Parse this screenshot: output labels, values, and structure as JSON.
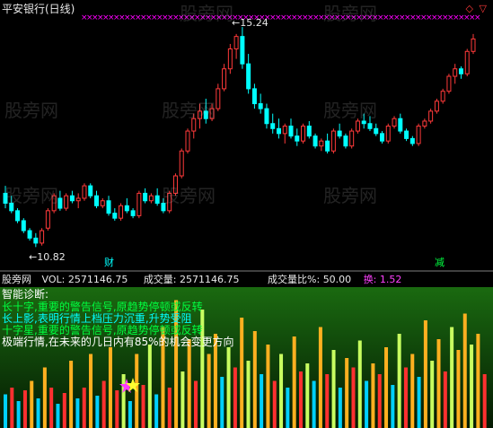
{
  "window": {
    "title": "平安银行(日线)",
    "close_icon": "diamond-close-icon",
    "restore_icon": "triangle-restore-icon"
  },
  "price_panel": {
    "high_label": "15.24",
    "low_label": "10.82",
    "markers": [
      "财",
      "减"
    ],
    "ghost_watermark": "股旁网",
    "candles": [
      [
        11.9,
        12.05,
        11.6,
        11.7
      ],
      [
        11.7,
        11.85,
        11.5,
        11.55
      ],
      [
        11.55,
        11.6,
        11.3,
        11.35
      ],
      [
        11.35,
        11.4,
        11.1,
        11.15
      ],
      [
        11.15,
        11.2,
        10.95,
        11.0
      ],
      [
        11.0,
        11.1,
        10.82,
        10.9
      ],
      [
        10.9,
        11.2,
        10.85,
        11.15
      ],
      [
        11.2,
        11.6,
        11.15,
        11.55
      ],
      [
        11.55,
        11.9,
        11.5,
        11.85
      ],
      [
        11.8,
        11.95,
        11.55,
        11.6
      ],
      [
        11.6,
        11.9,
        11.55,
        11.85
      ],
      [
        11.85,
        11.95,
        11.7,
        11.75
      ],
      [
        11.75,
        11.9,
        11.6,
        11.8
      ],
      [
        11.8,
        12.1,
        11.75,
        12.05
      ],
      [
        12.05,
        12.1,
        11.8,
        11.85
      ],
      [
        11.85,
        11.95,
        11.6,
        11.65
      ],
      [
        11.65,
        11.8,
        11.6,
        11.75
      ],
      [
        11.75,
        11.85,
        11.45,
        11.5
      ],
      [
        11.5,
        11.6,
        11.35,
        11.4
      ],
      [
        11.4,
        11.7,
        11.35,
        11.65
      ],
      [
        11.65,
        11.8,
        11.5,
        11.55
      ],
      [
        11.55,
        11.6,
        11.4,
        11.45
      ],
      [
        11.45,
        11.95,
        11.4,
        11.9
      ],
      [
        11.9,
        12.0,
        11.7,
        11.75
      ],
      [
        11.75,
        11.9,
        11.7,
        11.85
      ],
      [
        11.85,
        12.0,
        11.65,
        11.7
      ],
      [
        11.7,
        11.8,
        11.5,
        11.55
      ],
      [
        11.55,
        11.95,
        11.5,
        11.9
      ],
      [
        11.9,
        12.3,
        11.85,
        12.25
      ],
      [
        12.25,
        12.8,
        12.2,
        12.75
      ],
      [
        12.75,
        13.2,
        12.7,
        13.15
      ],
      [
        13.15,
        13.5,
        13.0,
        13.4
      ],
      [
        13.4,
        13.7,
        13.2,
        13.55
      ],
      [
        13.55,
        13.8,
        13.3,
        13.4
      ],
      [
        13.4,
        13.7,
        13.35,
        13.6
      ],
      [
        13.6,
        14.1,
        13.55,
        14.0
      ],
      [
        14.0,
        14.5,
        13.95,
        14.4
      ],
      [
        14.4,
        14.9,
        14.3,
        14.8
      ],
      [
        14.8,
        15.1,
        14.6,
        15.05
      ],
      [
        15.05,
        15.24,
        14.4,
        14.5
      ],
      [
        14.5,
        14.7,
        13.9,
        14.0
      ],
      [
        14.0,
        14.1,
        13.6,
        13.7
      ],
      [
        13.7,
        13.9,
        13.5,
        13.6
      ],
      [
        13.6,
        13.7,
        13.2,
        13.3
      ],
      [
        13.3,
        13.5,
        13.1,
        13.2
      ],
      [
        13.2,
        13.4,
        13.0,
        13.1
      ],
      [
        13.1,
        13.3,
        12.9,
        13.25
      ],
      [
        13.25,
        13.4,
        13.0,
        13.05
      ],
      [
        13.05,
        13.2,
        12.85,
        12.95
      ],
      [
        12.95,
        13.3,
        12.9,
        13.25
      ],
      [
        13.25,
        13.35,
        13.0,
        13.05
      ],
      [
        13.05,
        13.1,
        12.8,
        12.85
      ],
      [
        12.85,
        13.0,
        12.75,
        12.95
      ],
      [
        12.95,
        13.1,
        12.7,
        12.75
      ],
      [
        12.75,
        13.2,
        12.7,
        13.15
      ],
      [
        13.15,
        13.3,
        13.0,
        13.05
      ],
      [
        13.05,
        13.1,
        12.8,
        12.85
      ],
      [
        12.85,
        13.2,
        12.8,
        13.15
      ],
      [
        13.15,
        13.4,
        13.1,
        13.35
      ],
      [
        13.35,
        13.5,
        13.2,
        13.3
      ],
      [
        13.3,
        13.45,
        13.15,
        13.2
      ],
      [
        13.2,
        13.3,
        13.05,
        13.1
      ],
      [
        13.1,
        13.15,
        12.9,
        12.95
      ],
      [
        12.95,
        13.3,
        12.9,
        13.25
      ],
      [
        13.25,
        13.45,
        13.2,
        13.4
      ],
      [
        13.4,
        13.5,
        13.1,
        13.15
      ],
      [
        13.15,
        13.2,
        12.95,
        13.0
      ],
      [
        13.0,
        13.05,
        12.85,
        12.9
      ],
      [
        12.9,
        13.3,
        12.85,
        13.25
      ],
      [
        13.25,
        13.4,
        13.2,
        13.35
      ],
      [
        13.35,
        13.6,
        13.3,
        13.55
      ],
      [
        13.55,
        13.8,
        13.5,
        13.75
      ],
      [
        13.75,
        14.0,
        13.7,
        13.95
      ],
      [
        13.95,
        14.3,
        13.9,
        14.25
      ],
      [
        14.25,
        14.5,
        14.1,
        14.4
      ],
      [
        14.4,
        14.45,
        14.2,
        14.3
      ],
      [
        14.3,
        14.8,
        14.25,
        14.75
      ],
      [
        14.75,
        15.1,
        14.7,
        15.0
      ]
    ]
  },
  "volume_header": {
    "vol_label": "VOL:",
    "vol_value": "2571146.75",
    "turnover_label": "成交量:",
    "turnover_value": "2571146.75",
    "ratio_label": "成交量比%:",
    "ratio_value": "50.00",
    "exchange_label": "换:",
    "exchange_value": "1.52"
  },
  "diagnosis": {
    "title": "智能诊断:",
    "lines": [
      "长十字,重要的警告信号,原趋势停顿或反转",
      "长上影,表明行情上档压力沉重,升势受阻",
      "十字星,重要的警告信号,原趋势停顿或反转",
      "极端行情,在未来的几日内有85%的机会变更方向"
    ]
  },
  "volume_panel": {
    "bars": [
      [
        0.25,
        "#00d0ff"
      ],
      [
        0.3,
        "#ff3030"
      ],
      [
        0.2,
        "#00d0ff"
      ],
      [
        0.28,
        "#ff3030"
      ],
      [
        0.35,
        "#ffb020"
      ],
      [
        0.22,
        "#00d0ff"
      ],
      [
        0.45,
        "#ffb020"
      ],
      [
        0.3,
        "#ff3030"
      ],
      [
        0.18,
        "#00d0ff"
      ],
      [
        0.26,
        "#ff3030"
      ],
      [
        0.5,
        "#ffb020"
      ],
      [
        0.22,
        "#00d0ff"
      ],
      [
        0.3,
        "#ff3030"
      ],
      [
        0.55,
        "#ffb020"
      ],
      [
        0.24,
        "#00d0ff"
      ],
      [
        0.35,
        "#ff3030"
      ],
      [
        0.6,
        "#ffb020"
      ],
      [
        0.28,
        "#ff3030"
      ],
      [
        0.4,
        "#c8ff60"
      ],
      [
        0.2,
        "#00d0ff"
      ],
      [
        0.55,
        "#ffb020"
      ],
      [
        0.32,
        "#ff3030"
      ],
      [
        0.62,
        "#c8ff60"
      ],
      [
        0.25,
        "#00d0ff"
      ],
      [
        0.75,
        "#ffb020"
      ],
      [
        0.3,
        "#ff3030"
      ],
      [
        0.95,
        "#ffb020"
      ],
      [
        0.42,
        "#c8ff60"
      ],
      [
        0.66,
        "#ffb020"
      ],
      [
        0.35,
        "#ff3030"
      ],
      [
        0.88,
        "#c8ff60"
      ],
      [
        0.55,
        "#ffb020"
      ],
      [
        0.7,
        "#ffb020"
      ],
      [
        0.38,
        "#00d0ff"
      ],
      [
        0.6,
        "#c8ff60"
      ],
      [
        0.45,
        "#ff3030"
      ],
      [
        0.82,
        "#ffb020"
      ],
      [
        0.5,
        "#c8ff60"
      ],
      [
        0.72,
        "#ffb020"
      ],
      [
        0.4,
        "#00d0ff"
      ],
      [
        0.62,
        "#ffb020"
      ],
      [
        0.35,
        "#ff3030"
      ],
      [
        0.55,
        "#c8ff60"
      ],
      [
        0.3,
        "#00d0ff"
      ],
      [
        0.68,
        "#ffb020"
      ],
      [
        0.42,
        "#ff3030"
      ],
      [
        0.48,
        "#c8ff60"
      ],
      [
        0.35,
        "#00d0ff"
      ],
      [
        0.75,
        "#ffb020"
      ],
      [
        0.4,
        "#ff3030"
      ],
      [
        0.58,
        "#c8ff60"
      ],
      [
        0.3,
        "#00d0ff"
      ],
      [
        0.52,
        "#ffb020"
      ],
      [
        0.45,
        "#ff3030"
      ],
      [
        0.65,
        "#c8ff60"
      ],
      [
        0.35,
        "#00d0ff"
      ],
      [
        0.48,
        "#ffb020"
      ],
      [
        0.4,
        "#ff3030"
      ],
      [
        0.6,
        "#ffb020"
      ],
      [
        0.32,
        "#00d0ff"
      ],
      [
        0.7,
        "#c8ff60"
      ],
      [
        0.45,
        "#ff3030"
      ],
      [
        0.55,
        "#ffb020"
      ],
      [
        0.38,
        "#00d0ff"
      ],
      [
        0.8,
        "#ffb020"
      ],
      [
        0.5,
        "#c8ff60"
      ],
      [
        0.66,
        "#ffb020"
      ],
      [
        0.42,
        "#ff3030"
      ],
      [
        0.75,
        "#c8ff60"
      ],
      [
        0.58,
        "#ffb020"
      ],
      [
        0.85,
        "#ffb020"
      ],
      [
        0.62,
        "#c8ff60"
      ],
      [
        0.7,
        "#ffb020"
      ],
      [
        0.4,
        "#ff3030"
      ]
    ]
  },
  "colors": {
    "up": "#ff3a3a",
    "down": "#00ffff",
    "marker_cross": "#ff00ff",
    "title": "#e8e8e8",
    "vol_label": "#e8e8e8",
    "turnover_value": "#e8e8e8",
    "exchange": "#ff40ff",
    "diag_title": "#ffffff",
    "diag_1": "#00ff40",
    "diag_2": "#00ffff",
    "diag_3": "#00ff40",
    "diag_4": "#ffffff",
    "panel_green": "#0a4a0a",
    "marker_cai": "#00ffff",
    "marker_jian": "#00ff40"
  }
}
